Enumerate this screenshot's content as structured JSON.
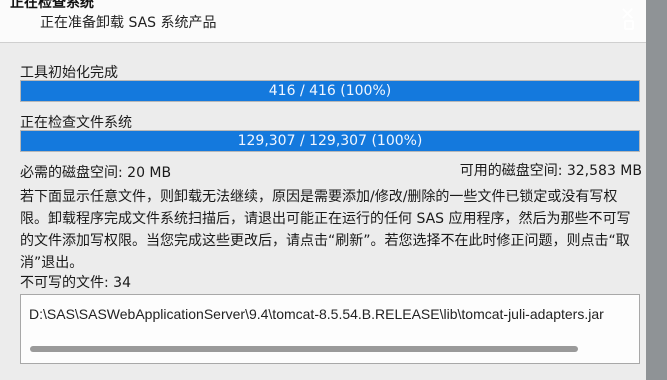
{
  "header": {
    "title": "正在检查系统",
    "status": "正在准备卸载 SAS 系统产品"
  },
  "progress_init": {
    "label": "工具初始化完成",
    "text": "416 / 416 (100%)",
    "percent": 100
  },
  "progress_fs": {
    "label": "正在检查文件系统",
    "text": "129,307 / 129,307 (100%)",
    "percent": 100
  },
  "disk": {
    "required": "必需的磁盘空间: 20 MB",
    "available": "可用的磁盘空间: 32,583 MB"
  },
  "message": "若下面显示任意文件，则卸载无法继续，原因是需要添加/修改/删除的一些文件已锁定或没有写权限。卸载程序完成文件系统扫描后，请退出可能正在运行的任何 SAS 应用程序，然后为那些不可写的文件添加写权限。当您完成这些更改后，请点击“刷新”。若您选择不在此时修正问题，则点击“取消”退出。",
  "unwritable": {
    "label": "不可写的文件: 34",
    "file_path": "D:\\SAS\\SASWebApplicationServer\\9.4\\tomcat-8.5.54.B.RELEASE\\lib\\tomcat-juli-adapters.jar"
  },
  "colors": {
    "progress_fill": "#1479dd",
    "window_bg": "#ececec"
  },
  "icons": [
    "close-icon",
    "restore-icon"
  ]
}
